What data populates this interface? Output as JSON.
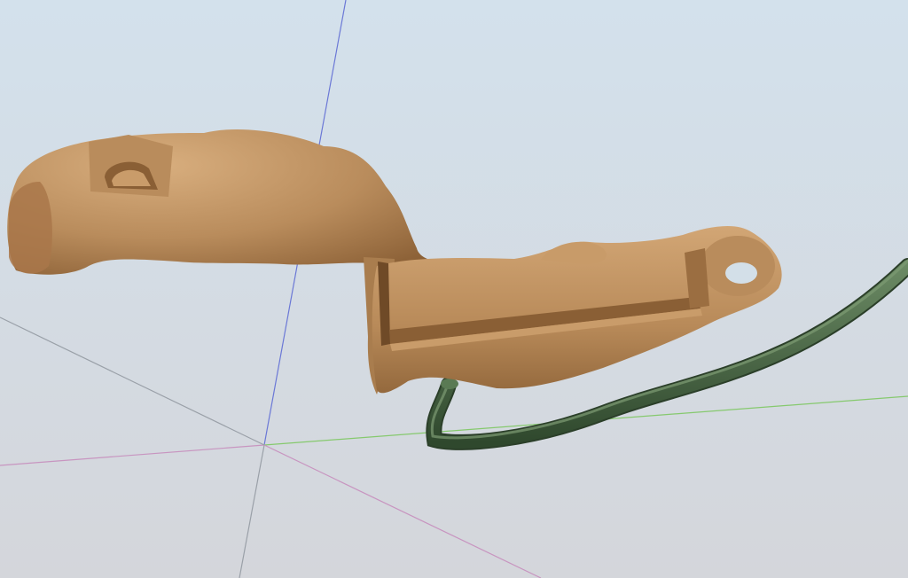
{
  "viewport": {
    "kind": "3d-model-viewer",
    "background": {
      "top_color": "#d3e1ec",
      "bottom_color": "#d4d6db"
    },
    "axes": {
      "x_axis_color": "#86c96e",
      "y_axis_color": "#6b78d6",
      "z_axis_color": "#c895c0",
      "grid_line_color": "#9aa0a8"
    },
    "model": {
      "name": "",
      "body_color": "#b98c5c",
      "body_highlight": "#d8ae7e",
      "body_shadow": "#8a5f35"
    },
    "tube": {
      "color": "#3f5d3c",
      "highlight": "#6b8a64"
    }
  }
}
